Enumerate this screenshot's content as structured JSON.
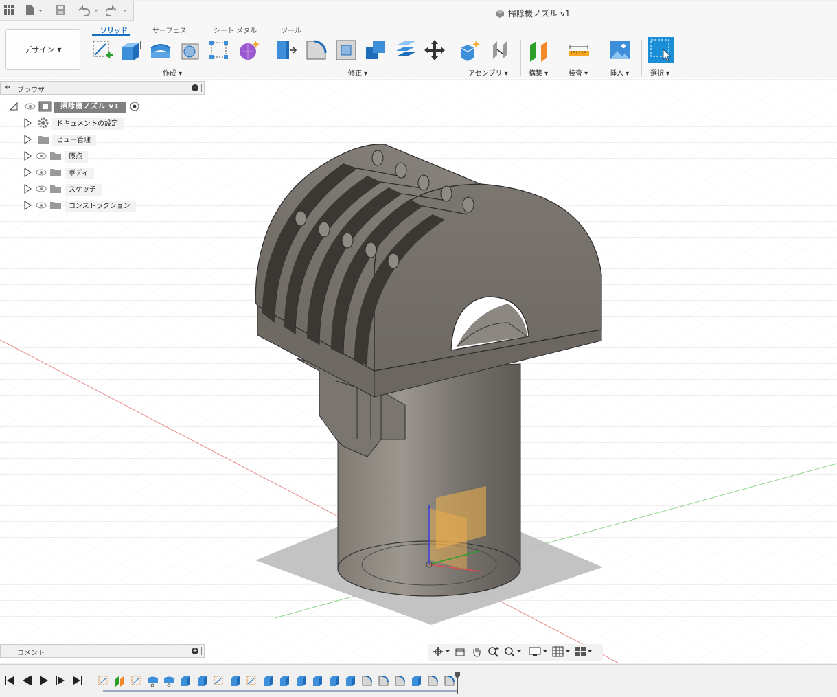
{
  "titlebar": {
    "document_title": "掃除機ノズル v1"
  },
  "ribbon": {
    "workspace": "デザイン",
    "tabs": [
      {
        "label": "ソリッド",
        "active": true
      },
      {
        "label": "サーフェス",
        "active": false
      },
      {
        "label": "シート メタル",
        "active": false
      },
      {
        "label": "ツール",
        "active": false
      }
    ],
    "groups": {
      "create": "作成",
      "modify": "修正",
      "assemble": "アセンブリ",
      "construct": "構築",
      "inspect": "検査",
      "insert": "挿入",
      "select": "選択"
    },
    "accent_color": "#1a6fc0"
  },
  "browser": {
    "title": "ブラウザ",
    "root": "掃除機ノズル v1",
    "items": [
      {
        "label": "ドキュメントの設定",
        "icon": "gear-icon"
      },
      {
        "label": "ビュー管理",
        "icon": "folder-icon"
      },
      {
        "label": "原点",
        "icon": "folder-icon"
      },
      {
        "label": "ボディ",
        "icon": "folder-icon"
      },
      {
        "label": "スケッチ",
        "icon": "folder-icon"
      },
      {
        "label": "コンストラクション",
        "icon": "folder-icon"
      }
    ]
  },
  "comments": {
    "title": "コメント"
  }
}
